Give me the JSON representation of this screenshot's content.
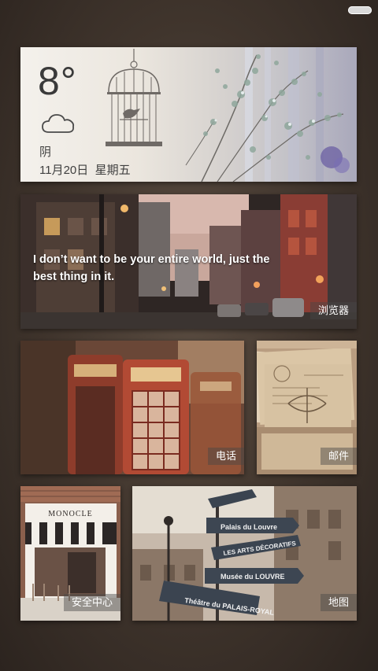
{
  "weather": {
    "temperature": "8°",
    "condition": "阴",
    "date": "11月20日",
    "weekday": "星期五",
    "icon": "cloud-icon"
  },
  "browser": {
    "quote": "I don’t want to be your entire world, just the best thing in it.",
    "label": "浏览器"
  },
  "phone": {
    "label": "电话"
  },
  "mail": {
    "label": "邮件"
  },
  "security": {
    "label": "安全中心",
    "shop_sign": "MONOCLE"
  },
  "map": {
    "label": "地图",
    "signs": [
      "Palais du Louvre",
      "LES ARTS DÉCORATIFS",
      "Musée du LOUVRE",
      "Théâtre du PALAIS-ROYAL"
    ]
  },
  "colors": {
    "tile_label_bg": "rgba(70,70,70,0.45)",
    "wallpaper": "#3f342c"
  }
}
